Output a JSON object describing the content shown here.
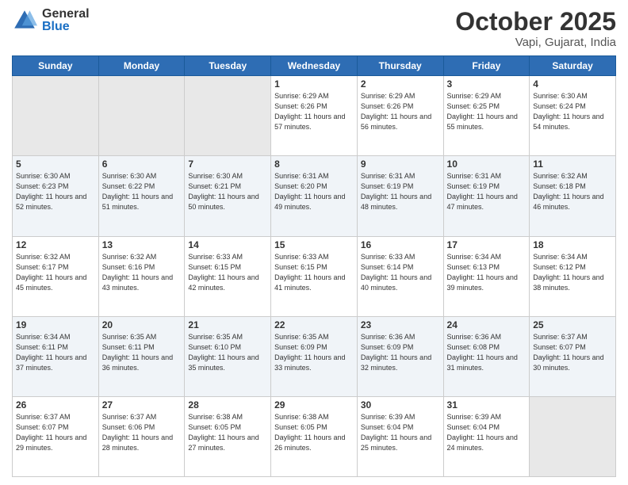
{
  "header": {
    "logo_general": "General",
    "logo_blue": "Blue",
    "month": "October 2025",
    "location": "Vapi, Gujarat, India"
  },
  "days_of_week": [
    "Sunday",
    "Monday",
    "Tuesday",
    "Wednesday",
    "Thursday",
    "Friday",
    "Saturday"
  ],
  "weeks": [
    [
      {
        "day": "",
        "info": ""
      },
      {
        "day": "",
        "info": ""
      },
      {
        "day": "",
        "info": ""
      },
      {
        "day": "1",
        "info": "Sunrise: 6:29 AM\nSunset: 6:26 PM\nDaylight: 11 hours\nand 57 minutes."
      },
      {
        "day": "2",
        "info": "Sunrise: 6:29 AM\nSunset: 6:26 PM\nDaylight: 11 hours\nand 56 minutes."
      },
      {
        "day": "3",
        "info": "Sunrise: 6:29 AM\nSunset: 6:25 PM\nDaylight: 11 hours\nand 55 minutes."
      },
      {
        "day": "4",
        "info": "Sunrise: 6:30 AM\nSunset: 6:24 PM\nDaylight: 11 hours\nand 54 minutes."
      }
    ],
    [
      {
        "day": "5",
        "info": "Sunrise: 6:30 AM\nSunset: 6:23 PM\nDaylight: 11 hours\nand 52 minutes."
      },
      {
        "day": "6",
        "info": "Sunrise: 6:30 AM\nSunset: 6:22 PM\nDaylight: 11 hours\nand 51 minutes."
      },
      {
        "day": "7",
        "info": "Sunrise: 6:30 AM\nSunset: 6:21 PM\nDaylight: 11 hours\nand 50 minutes."
      },
      {
        "day": "8",
        "info": "Sunrise: 6:31 AM\nSunset: 6:20 PM\nDaylight: 11 hours\nand 49 minutes."
      },
      {
        "day": "9",
        "info": "Sunrise: 6:31 AM\nSunset: 6:19 PM\nDaylight: 11 hours\nand 48 minutes."
      },
      {
        "day": "10",
        "info": "Sunrise: 6:31 AM\nSunset: 6:19 PM\nDaylight: 11 hours\nand 47 minutes."
      },
      {
        "day": "11",
        "info": "Sunrise: 6:32 AM\nSunset: 6:18 PM\nDaylight: 11 hours\nand 46 minutes."
      }
    ],
    [
      {
        "day": "12",
        "info": "Sunrise: 6:32 AM\nSunset: 6:17 PM\nDaylight: 11 hours\nand 45 minutes."
      },
      {
        "day": "13",
        "info": "Sunrise: 6:32 AM\nSunset: 6:16 PM\nDaylight: 11 hours\nand 43 minutes."
      },
      {
        "day": "14",
        "info": "Sunrise: 6:33 AM\nSunset: 6:15 PM\nDaylight: 11 hours\nand 42 minutes."
      },
      {
        "day": "15",
        "info": "Sunrise: 6:33 AM\nSunset: 6:15 PM\nDaylight: 11 hours\nand 41 minutes."
      },
      {
        "day": "16",
        "info": "Sunrise: 6:33 AM\nSunset: 6:14 PM\nDaylight: 11 hours\nand 40 minutes."
      },
      {
        "day": "17",
        "info": "Sunrise: 6:34 AM\nSunset: 6:13 PM\nDaylight: 11 hours\nand 39 minutes."
      },
      {
        "day": "18",
        "info": "Sunrise: 6:34 AM\nSunset: 6:12 PM\nDaylight: 11 hours\nand 38 minutes."
      }
    ],
    [
      {
        "day": "19",
        "info": "Sunrise: 6:34 AM\nSunset: 6:11 PM\nDaylight: 11 hours\nand 37 minutes."
      },
      {
        "day": "20",
        "info": "Sunrise: 6:35 AM\nSunset: 6:11 PM\nDaylight: 11 hours\nand 36 minutes."
      },
      {
        "day": "21",
        "info": "Sunrise: 6:35 AM\nSunset: 6:10 PM\nDaylight: 11 hours\nand 35 minutes."
      },
      {
        "day": "22",
        "info": "Sunrise: 6:35 AM\nSunset: 6:09 PM\nDaylight: 11 hours\nand 33 minutes."
      },
      {
        "day": "23",
        "info": "Sunrise: 6:36 AM\nSunset: 6:09 PM\nDaylight: 11 hours\nand 32 minutes."
      },
      {
        "day": "24",
        "info": "Sunrise: 6:36 AM\nSunset: 6:08 PM\nDaylight: 11 hours\nand 31 minutes."
      },
      {
        "day": "25",
        "info": "Sunrise: 6:37 AM\nSunset: 6:07 PM\nDaylight: 11 hours\nand 30 minutes."
      }
    ],
    [
      {
        "day": "26",
        "info": "Sunrise: 6:37 AM\nSunset: 6:07 PM\nDaylight: 11 hours\nand 29 minutes."
      },
      {
        "day": "27",
        "info": "Sunrise: 6:37 AM\nSunset: 6:06 PM\nDaylight: 11 hours\nand 28 minutes."
      },
      {
        "day": "28",
        "info": "Sunrise: 6:38 AM\nSunset: 6:05 PM\nDaylight: 11 hours\nand 27 minutes."
      },
      {
        "day": "29",
        "info": "Sunrise: 6:38 AM\nSunset: 6:05 PM\nDaylight: 11 hours\nand 26 minutes."
      },
      {
        "day": "30",
        "info": "Sunrise: 6:39 AM\nSunset: 6:04 PM\nDaylight: 11 hours\nand 25 minutes."
      },
      {
        "day": "31",
        "info": "Sunrise: 6:39 AM\nSunset: 6:04 PM\nDaylight: 11 hours\nand 24 minutes."
      },
      {
        "day": "",
        "info": ""
      }
    ]
  ]
}
